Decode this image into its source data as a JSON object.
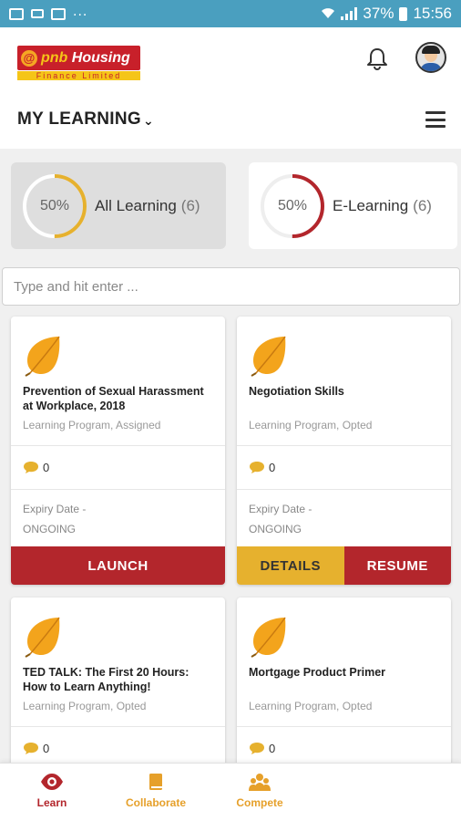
{
  "status_bar": {
    "battery": "37%",
    "time": "15:56",
    "dots": "..."
  },
  "header": {
    "logo_mark": "@",
    "logo_brand_a": "pnb",
    "logo_brand_b": "Housing",
    "logo_sub": "Finance Limited",
    "page_title": "MY LEARNING",
    "title_chevron": "⌄"
  },
  "summary": {
    "all": {
      "percent_label": "50%",
      "percent": 0.5,
      "label": "All Learning",
      "count": "(6)",
      "ring_color": "#e6b12e"
    },
    "elearning": {
      "percent_label": "50%",
      "percent": 0.5,
      "label": "E-Learning",
      "count": "(6)",
      "ring_color": "#b3262c"
    }
  },
  "search": {
    "placeholder": "Type and hit enter ..."
  },
  "courses": [
    {
      "title": "Prevention of Sexual Harassment at Workplace, 2018",
      "type": "Learning Program, Assigned",
      "comments": "0",
      "expiry_label": "Expiry Date -",
      "expiry_value": "ONGOING",
      "launch_label": "LAUNCH"
    },
    {
      "title": "Negotiation Skills",
      "type": "Learning Program, Opted",
      "comments": "0",
      "expiry_label": "Expiry Date -",
      "expiry_value": "ONGOING",
      "details_label": "DETAILS",
      "resume_label": "RESUME"
    },
    {
      "title": "TED TALK: The First 20 Hours: How to Learn Anything!",
      "type": "Learning Program, Opted",
      "comments": "0"
    },
    {
      "title": "Mortgage Product Primer",
      "type": "Learning Program, Opted",
      "comments": "0"
    }
  ],
  "bottom_nav": {
    "learn": {
      "label": "Learn",
      "icon": "eye-icon",
      "color": "#b3262c"
    },
    "collaborate": {
      "label": "Collaborate",
      "icon": "book-icon",
      "color": "#e6a02a"
    },
    "compete": {
      "label": "Compete",
      "icon": "people-icon",
      "color": "#e6a02a"
    }
  }
}
